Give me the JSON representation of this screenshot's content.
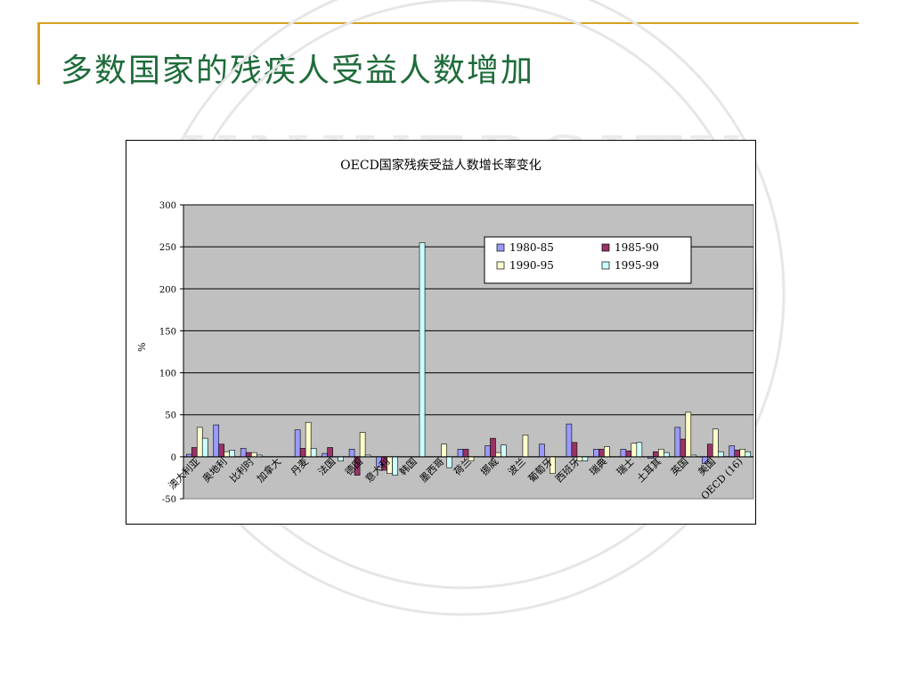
{
  "slide": {
    "title": "多数国家的残疾人受益人数增加"
  },
  "watermark": {
    "text": "UNIVERSITY"
  },
  "colors": {
    "accent_rule": "#D4A020",
    "title_text": "#1E6B3A",
    "plot_background": "#C0C0C0"
  },
  "chart_data": {
    "type": "bar",
    "title": "OECD国家残疾受益人数增长率变化",
    "xlabel": "",
    "ylabel": "%",
    "ylim": [
      -50,
      300
    ],
    "yticks": [
      -50,
      0,
      50,
      100,
      150,
      200,
      250,
      300
    ],
    "grid": true,
    "legend_position": "top-right",
    "categories": [
      "澳大利亚",
      "奥地利",
      "比利时",
      "加拿大",
      "丹麦",
      "法国",
      "德国",
      "意大利",
      "韩国",
      "墨西哥",
      "荷兰",
      "挪威",
      "波兰",
      "葡萄牙",
      "西班牙",
      "瑞典",
      "瑞士",
      "土耳其",
      "英国",
      "美国",
      "OECD (16)"
    ],
    "tick_labels": [
      "澳大利亚",
      "奥地利",
      "比利时",
      "加拿大",
      "丹麦",
      "法国",
      "德国",
      "意大利",
      "韩国",
      "墨西哥",
      "荷兰",
      "挪威",
      "波兰",
      "葡萄牙",
      "西班牙",
      "瑞典",
      "瑞士",
      "土耳其",
      "英国",
      "美国",
      "OECD (16)"
    ],
    "series": [
      {
        "name": "1980-85",
        "color": "#9999FF",
        "values": [
          3,
          38,
          10,
          0,
          32,
          4,
          9,
          -12,
          null,
          null,
          9,
          13,
          null,
          15,
          39,
          9,
          9,
          -2,
          35,
          -8,
          13
        ]
      },
      {
        "name": "1985-90",
        "color": "#993366",
        "values": [
          11,
          15,
          5,
          0,
          10,
          11,
          -22,
          -16,
          null,
          null,
          9,
          22,
          null,
          0,
          17,
          9,
          7,
          6,
          21,
          15,
          8
        ]
      },
      {
        "name": "1990-95",
        "color": "#FFFFCC",
        "values": [
          35,
          6,
          5,
          0,
          41,
          0,
          29,
          -20,
          null,
          15,
          -5,
          5,
          26,
          -20,
          -5,
          12,
          16,
          9,
          53,
          33,
          9
        ]
      },
      {
        "name": "1995-99",
        "color": "#CCFFFF",
        "values": [
          22,
          8,
          2,
          0,
          10,
          -5,
          2,
          -22,
          255,
          -13,
          0,
          14,
          0,
          0,
          -5,
          0,
          17,
          5,
          2,
          6,
          6
        ]
      }
    ]
  }
}
